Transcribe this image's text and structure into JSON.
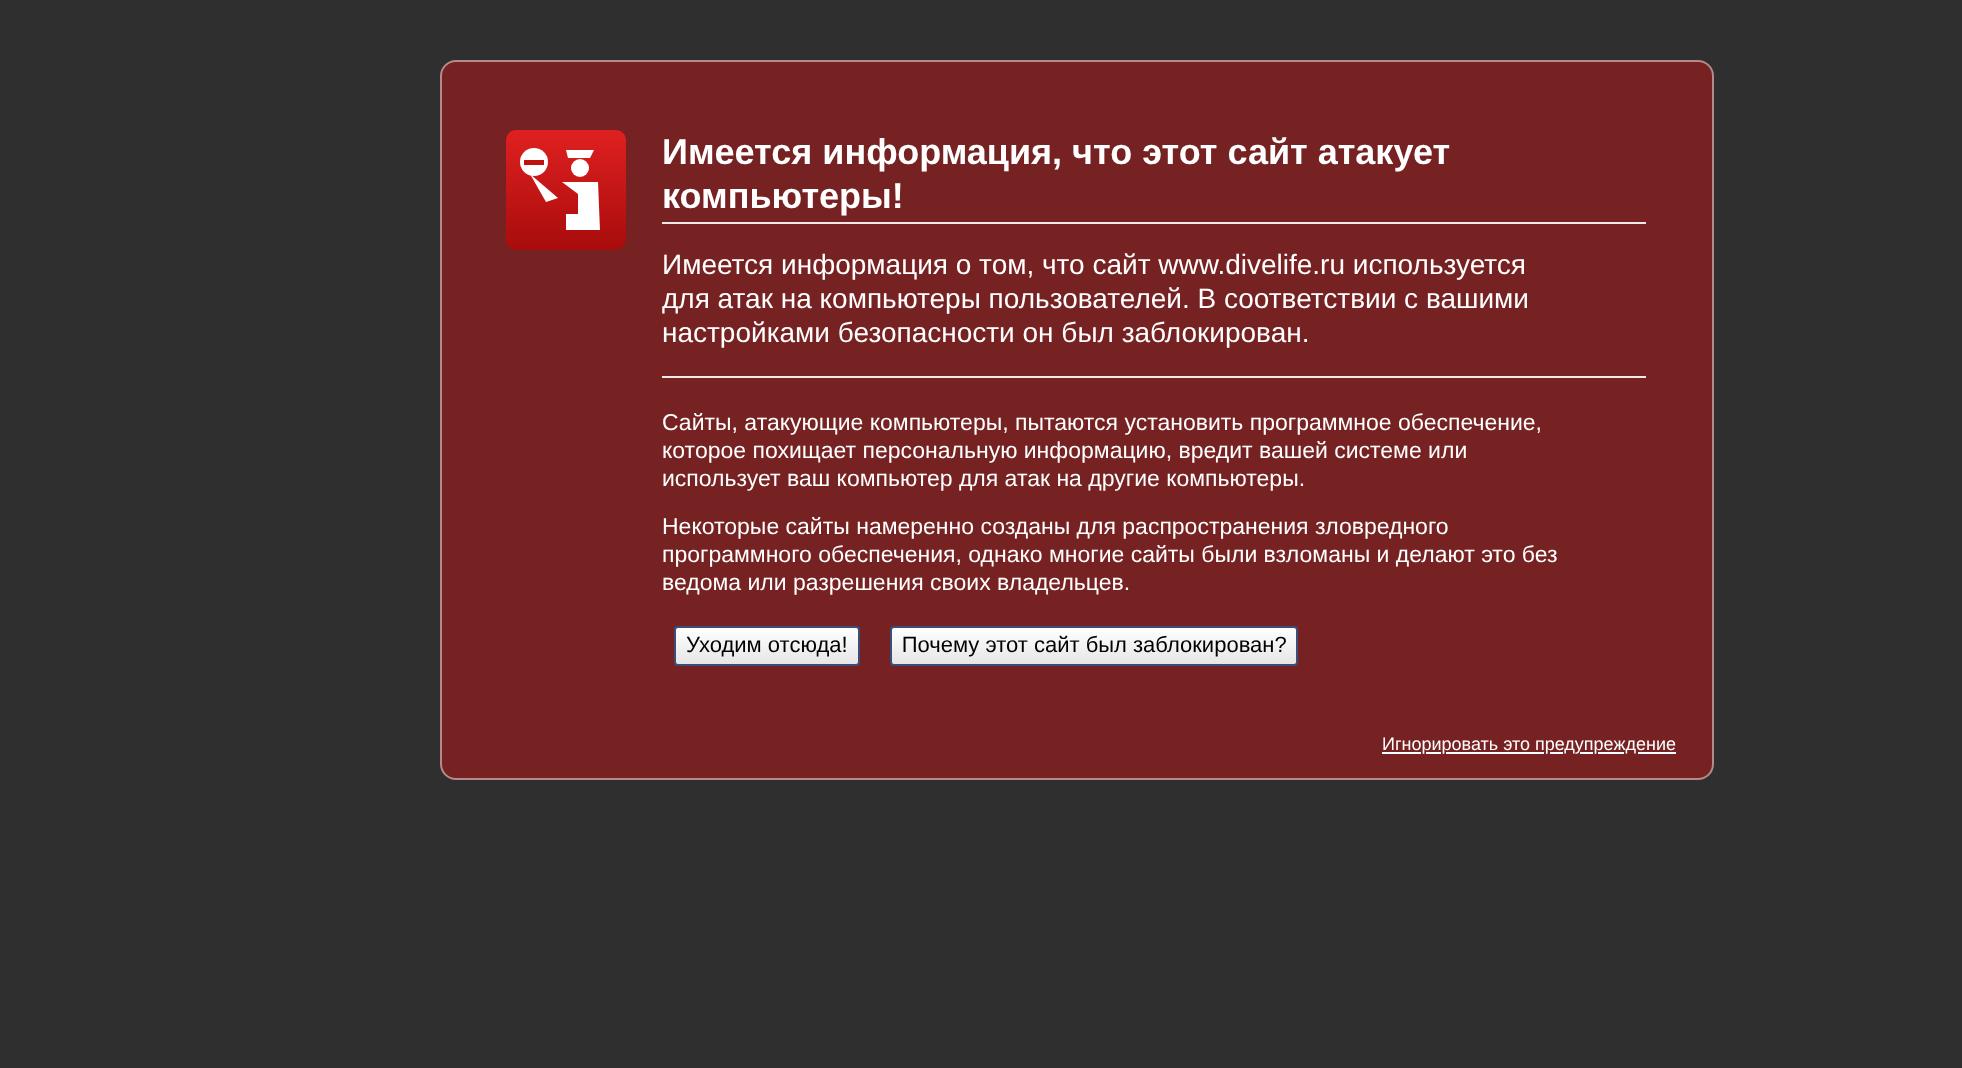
{
  "title": "Имеется информация, что этот сайт атакует компьютеры!",
  "intro": "Имеется информация о том, что сайт www.divelife.ru используется для атак на компьютеры пользователей. В соответствии с вашими настройками безопасности он был заблокирован.",
  "paragraphs": [
    "Сайты, атакующие компьютеры, пытаются установить программное обеспечение, которое похищает персональную информацию, вредит вашей системе или использует ваш компьютер для атак на другие компьютеры.",
    "Некоторые сайты намеренно созданы для распространения зловредного программного обеспечения, однако многие сайты были взломаны и делают это без ведома или разрешения своих владельцев."
  ],
  "buttons": [
    "Уходим отсюда!",
    "Почему этот сайт был заблокирован?"
  ],
  "ignore_link": "Игнорировать это предупреждение"
}
